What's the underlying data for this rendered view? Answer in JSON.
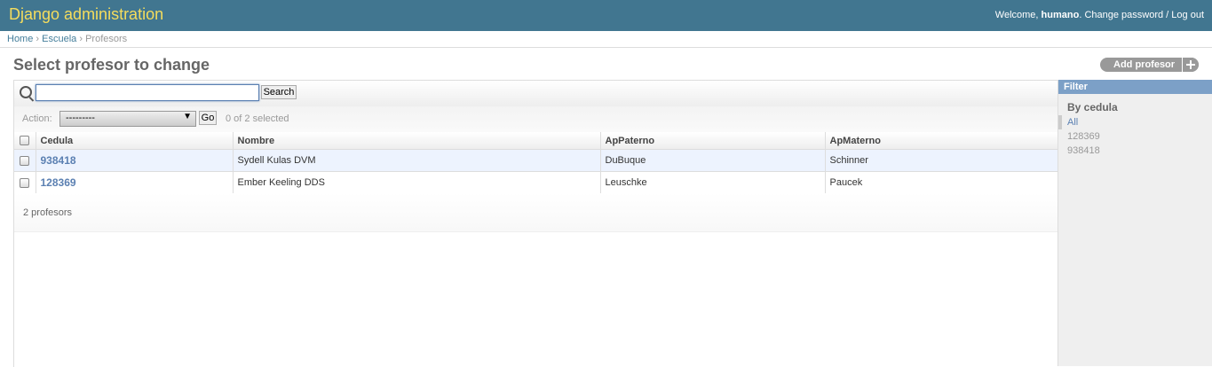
{
  "header": {
    "branding": "Django administration",
    "welcome": "Welcome,",
    "username": "humano",
    "change_password": "Change password",
    "separator": "/",
    "logout": "Log out"
  },
  "breadcrumbs": {
    "home": "Home",
    "app": "Escuela",
    "current": "Profesors",
    "sep": "›"
  },
  "page": {
    "title": "Select profesor to change",
    "add_button": "Add profesor"
  },
  "search": {
    "value": "",
    "button": "Search"
  },
  "actions": {
    "label": "Action:",
    "selected": "---------",
    "go": "Go",
    "counter": "0 of 2 selected"
  },
  "table": {
    "headers": [
      "Cedula",
      "Nombre",
      "ApPaterno",
      "ApMaterno"
    ],
    "rows": [
      {
        "cedula": "938418",
        "nombre": "Sydell Kulas DVM",
        "appaterno": "DuBuque",
        "apmaterno": "Schinner"
      },
      {
        "cedula": "128369",
        "nombre": "Ember Keeling DDS",
        "appaterno": "Leuschke",
        "apmaterno": "Paucek"
      }
    ]
  },
  "paginator": "2 profesors",
  "filter": {
    "title": "Filter",
    "heading": "By cedula",
    "options": [
      "All",
      "128369",
      "938418"
    ]
  }
}
